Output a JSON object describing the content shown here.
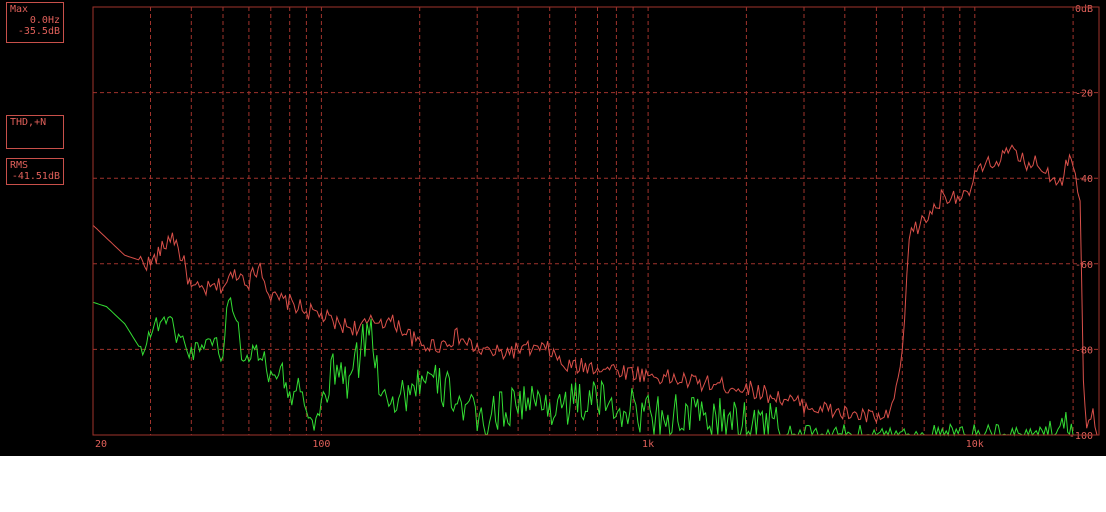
{
  "readouts": {
    "max": {
      "title": "Max",
      "freq": "0.0Hz",
      "level": "-35.5dB"
    },
    "thd": {
      "title": "THD,+N"
    },
    "rms": {
      "title": "RMS",
      "level": "-41.51dB"
    }
  },
  "colors": {
    "background": "#000000",
    "grid": "#a0332c",
    "series_red": "#d9504a",
    "series_green": "#33dd33",
    "text": "#e0605a"
  },
  "chart_data": {
    "type": "line",
    "xscale": "log",
    "xlim": [
      20,
      24000
    ],
    "ylim": [
      -100,
      0
    ],
    "xticks": [
      {
        "value": 20,
        "label": "20"
      },
      {
        "value": 100,
        "label": "100"
      },
      {
        "value": 1000,
        "label": "1k"
      },
      {
        "value": 10000,
        "label": "10k"
      }
    ],
    "yticks": [
      {
        "value": 0,
        "label": "0dB"
      },
      {
        "value": -20,
        "label": "-20"
      },
      {
        "value": -40,
        "label": "-40"
      },
      {
        "value": -60,
        "label": "-60"
      },
      {
        "value": -80,
        "label": "-80"
      },
      {
        "value": -100,
        "label": "-100"
      }
    ],
    "grid": true,
    "series": [
      {
        "color": "#d9504a",
        "points": [
          [
            20,
            -51
          ],
          [
            22,
            -54
          ],
          [
            25,
            -58
          ],
          [
            30,
            -60
          ],
          [
            33,
            -56
          ],
          [
            35,
            -53
          ],
          [
            38,
            -60
          ],
          [
            40,
            -66
          ],
          [
            45,
            -66
          ],
          [
            50,
            -65
          ],
          [
            55,
            -62
          ],
          [
            60,
            -64
          ],
          [
            65,
            -60
          ],
          [
            70,
            -68
          ],
          [
            80,
            -69
          ],
          [
            90,
            -71
          ],
          [
            100,
            -72
          ],
          [
            110,
            -74
          ],
          [
            130,
            -75
          ],
          [
            150,
            -73
          ],
          [
            170,
            -74
          ],
          [
            200,
            -79
          ],
          [
            230,
            -79
          ],
          [
            260,
            -77
          ],
          [
            300,
            -80
          ],
          [
            350,
            -81
          ],
          [
            400,
            -80
          ],
          [
            500,
            -80
          ],
          [
            550,
            -84
          ],
          [
            700,
            -84
          ],
          [
            1000,
            -86
          ],
          [
            1500,
            -88
          ],
          [
            2000,
            -89
          ],
          [
            3000,
            -93
          ],
          [
            4000,
            -95
          ],
          [
            5000,
            -96
          ],
          [
            5500,
            -96
          ],
          [
            6000,
            -82
          ],
          [
            6300,
            -53
          ],
          [
            7000,
            -50
          ],
          [
            7500,
            -47
          ],
          [
            8000,
            -44
          ],
          [
            9000,
            -44
          ],
          [
            9500,
            -45
          ],
          [
            10000,
            -39
          ],
          [
            11000,
            -37
          ],
          [
            12000,
            -35
          ],
          [
            13000,
            -34
          ],
          [
            14000,
            -36
          ],
          [
            16000,
            -37
          ],
          [
            17500,
            -40
          ],
          [
            18500,
            -40
          ],
          [
            19000,
            -36
          ],
          [
            20000,
            -36
          ],
          [
            21000,
            -44
          ],
          [
            21500,
            -86
          ],
          [
            22000,
            -97
          ],
          [
            23000,
            -95
          ],
          [
            24000,
            -100
          ]
        ]
      },
      {
        "color": "#33dd33",
        "points": [
          [
            20,
            -69
          ],
          [
            22,
            -70
          ],
          [
            25,
            -74
          ],
          [
            28,
            -80
          ],
          [
            30,
            -76
          ],
          [
            33,
            -72
          ],
          [
            36,
            -76
          ],
          [
            40,
            -81
          ],
          [
            45,
            -77
          ],
          [
            50,
            -81
          ],
          [
            52,
            -68
          ],
          [
            55,
            -72
          ],
          [
            57,
            -81
          ],
          [
            60,
            -81
          ],
          [
            65,
            -80
          ],
          [
            70,
            -87
          ],
          [
            75,
            -84
          ],
          [
            80,
            -92
          ],
          [
            85,
            -87
          ],
          [
            90,
            -95
          ],
          [
            95,
            -100
          ],
          [
            100,
            -92
          ],
          [
            110,
            -88
          ],
          [
            120,
            -91
          ],
          [
            130,
            -85
          ],
          [
            140,
            -77
          ],
          [
            150,
            -90
          ],
          [
            170,
            -95
          ],
          [
            200,
            -90
          ],
          [
            250,
            -93
          ],
          [
            300,
            -100
          ],
          [
            400,
            -95
          ],
          [
            500,
            -96
          ],
          [
            700,
            -95
          ],
          [
            1000,
            -98
          ],
          [
            1500,
            -99
          ],
          [
            2000,
            -100
          ],
          [
            3000,
            -100
          ],
          [
            15000,
            -100
          ],
          [
            16500,
            -98
          ],
          [
            17500,
            -100
          ],
          [
            19000,
            -96
          ],
          [
            20000,
            -100
          ]
        ]
      }
    ]
  }
}
